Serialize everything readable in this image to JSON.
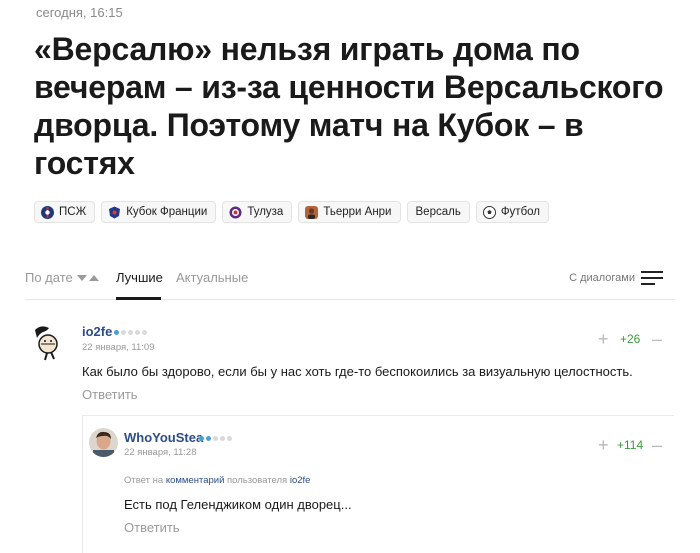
{
  "article": {
    "timestamp": "сегодня, 16:15",
    "title": "«Версалю» нельзя играть дома по вечерам – из-за ценности Версальского дворца. Поэтому матч на Кубок – в гостях"
  },
  "tags": [
    {
      "label": "ПСЖ",
      "icon": "psg-icon"
    },
    {
      "label": "Кубок Франции",
      "icon": "coupe-de-france-icon"
    },
    {
      "label": "Тулуза",
      "icon": "toulouse-icon"
    },
    {
      "label": "Тьерри Анри",
      "icon": "person-icon"
    },
    {
      "label": "Версаль",
      "icon": ""
    },
    {
      "label": "Футбол",
      "icon": "football-icon"
    }
  ],
  "comments_nav": {
    "sort_by_date": "По дате",
    "tab_best": "Лучшие",
    "tab_actual": "Актуальные",
    "dialogs": "С диалогами"
  },
  "comments": [
    {
      "username": "io2fe",
      "date": "22 января, 11:09",
      "text": "Как было бы здорово, если бы у нас хоть где-то беспокоились за визуальную целостность.",
      "score": "+26",
      "reply_label": "Ответить",
      "rating_level": 1
    },
    {
      "username": "WhoYouStea",
      "date": "22 января, 11:28",
      "reply_meta_prefix": "Ответ на",
      "reply_meta_link": "комментарий",
      "reply_meta_middle": "пользователя",
      "reply_meta_user": "io2fe",
      "text": "Есть под Геленджиком один дворец...",
      "score": "+114",
      "reply_label": "Ответить",
      "rating_level": 2
    }
  ],
  "colors": {
    "link": "#2b4d8c",
    "positive": "#3c9a3c",
    "muted": "#999999",
    "rating_on": "#4a9fd8"
  }
}
